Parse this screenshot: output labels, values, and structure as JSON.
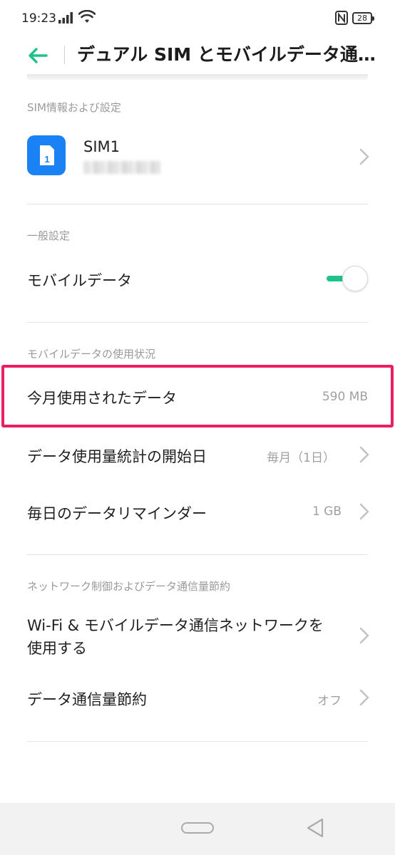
{
  "status_bar": {
    "time": "19:23",
    "battery": "28",
    "icons": [
      "signal-icon",
      "wifi-icon",
      "nfc-icon",
      "battery-icon"
    ]
  },
  "header": {
    "title": "デュアル SIM とモバイルデータ通...",
    "back_icon": "arrow-left-icon",
    "accent_color": "#1ec28b"
  },
  "sections": {
    "sim": {
      "label": "SIM情報および設定",
      "sim1_title": "SIM1",
      "sim1_icon_text": "1"
    },
    "general": {
      "label": "一般設定",
      "mobile_data_label": "モバイルデータ",
      "mobile_data_enabled": true
    },
    "usage": {
      "label": "モバイルデータの使用状況",
      "used_this_month_label": "今月使用されたデータ",
      "used_this_month_value": "590 MB",
      "stats_start_label": "データ使用量統計の開始日",
      "stats_start_value": "毎月（1日）",
      "daily_reminder_label": "毎日のデータリマインダー",
      "daily_reminder_value": "1 GB"
    },
    "network": {
      "label": "ネットワーク制御およびデータ通信量節約",
      "wifi_mobile_label_line1": "Wi-Fi & モバイルデータ通信ネットワークを",
      "wifi_mobile_label_line2": "使用する",
      "data_saver_label": "データ通信量節約",
      "data_saver_value": "オフ"
    }
  },
  "colors": {
    "highlight": "#e91e63",
    "sim_icon_bg": "#1a82f5",
    "toggle_on": "#1ec28b"
  }
}
